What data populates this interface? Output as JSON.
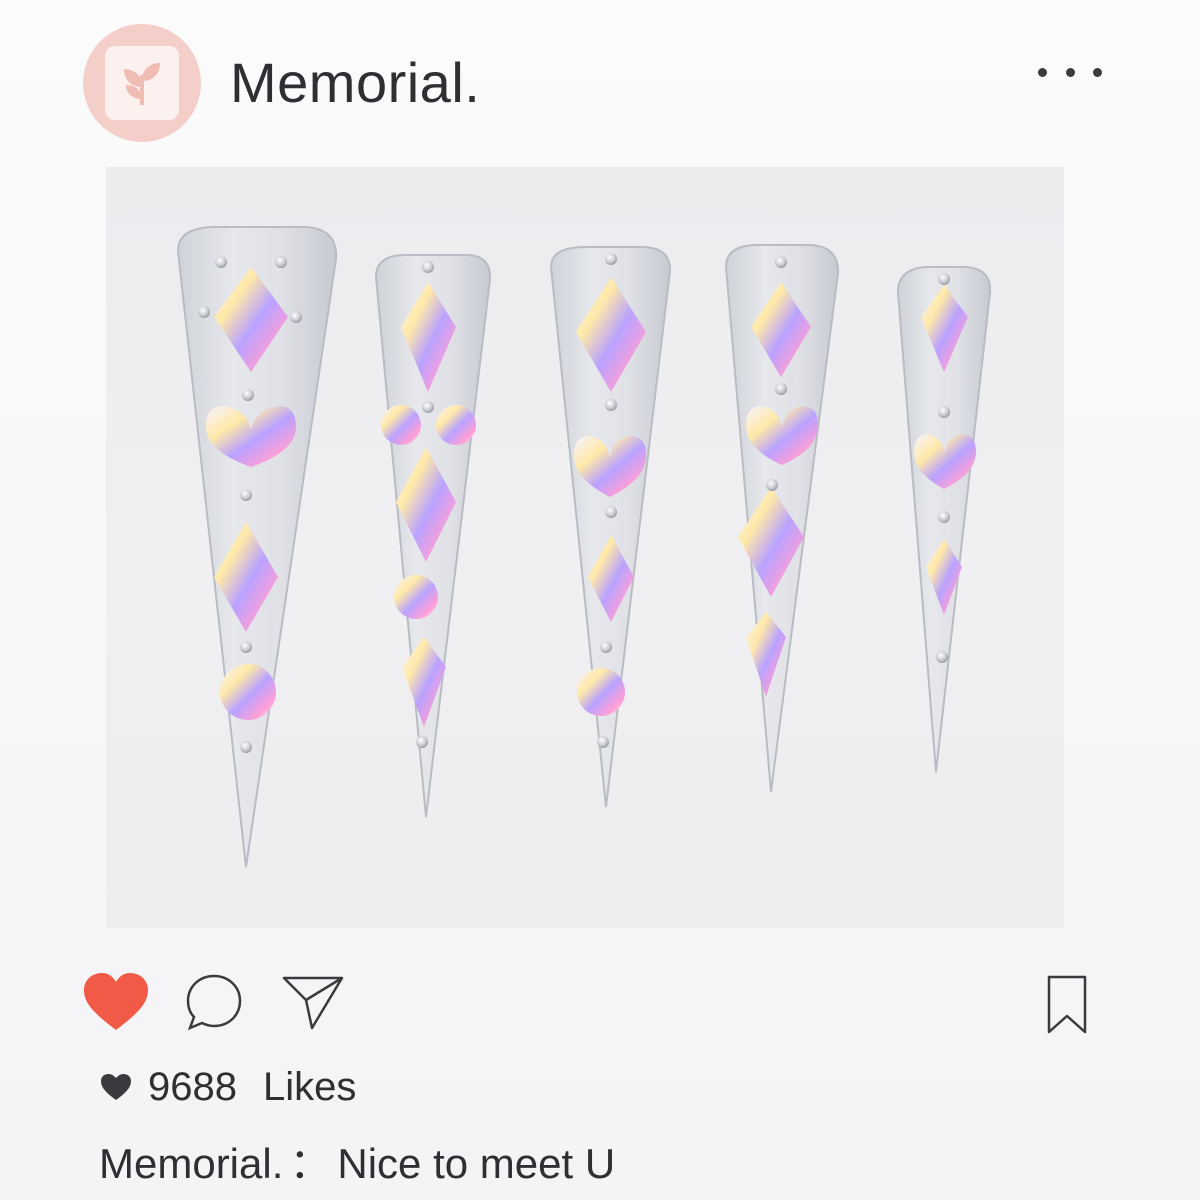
{
  "post": {
    "username": "Memorial.",
    "likes_count": "9688",
    "likes_label": "Likes",
    "caption_user": "Memorial.",
    "caption_separator": "：",
    "caption_text": "Nice to meet U"
  },
  "icons": {
    "avatar": "leaf-logo-icon",
    "more": "more-options-icon",
    "like": "heart-icon",
    "comment": "comment-icon",
    "share": "send-icon",
    "save": "bookmark-icon",
    "likes_small": "small-heart-icon"
  },
  "colors": {
    "like_active": "#f05a46",
    "avatar_bg": "#f4cfc9",
    "text": "#2f2f33"
  },
  "image": {
    "subject": "press-on stiletto nails with AB rhinestones",
    "nail_count": 5
  }
}
